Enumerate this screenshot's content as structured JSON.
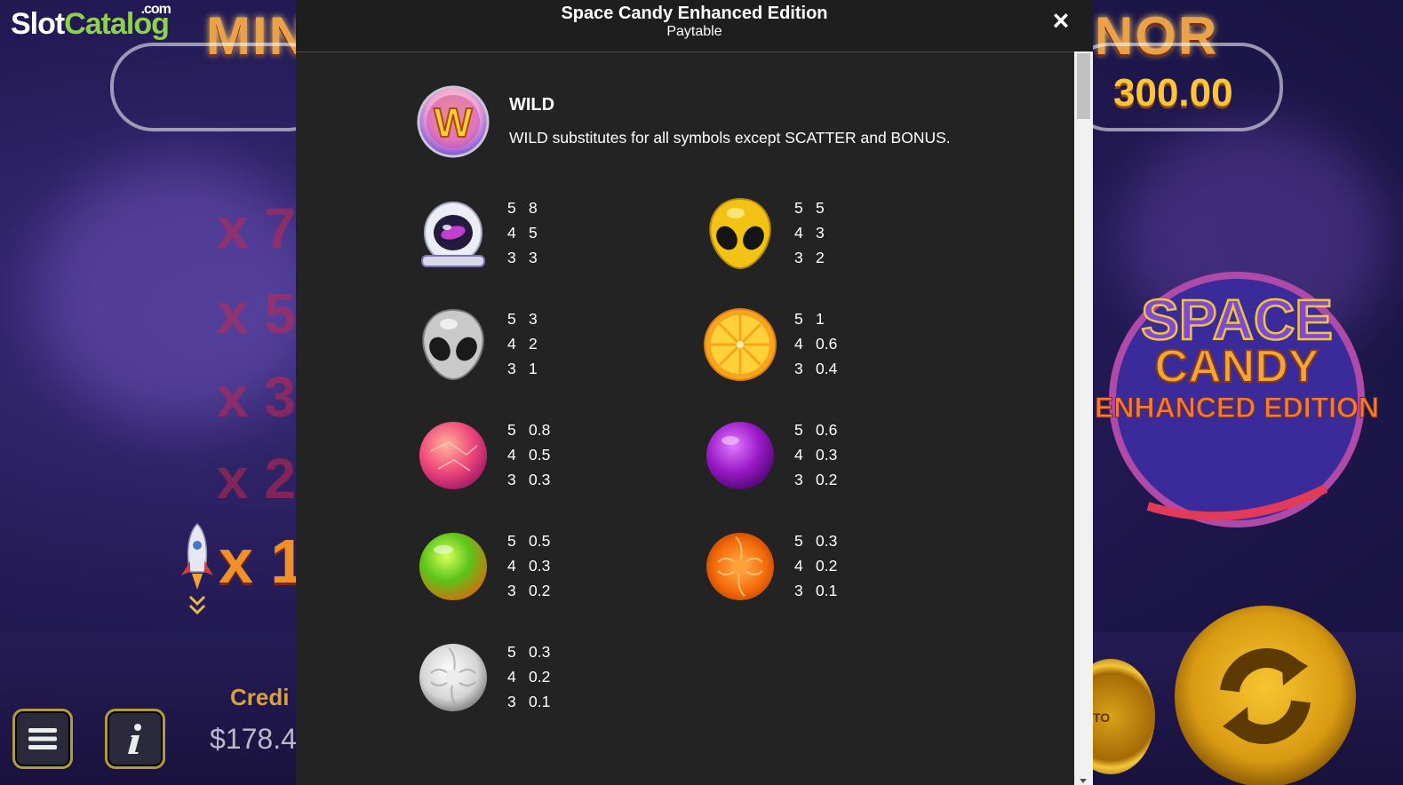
{
  "watermark": {
    "brand_part1": "Slot",
    "brand_part2": "Catalog",
    "brand_suffix": ".com"
  },
  "background": {
    "left_title_partial": "MIN",
    "right_title_partial": "NOR",
    "right_amount": "300.00",
    "multipliers": [
      "x 7",
      "x 5",
      "x 3",
      "x 2"
    ],
    "active_multiplier": "x 1",
    "credit_label": "Credi",
    "credit_value": "$178.4",
    "game_logo": {
      "line1": "SPACE",
      "line2": "CANDY",
      "line3": "ENHANCED EDITION"
    },
    "auto_label": "TO",
    "colors": {
      "accent_gold": "#ffc43a",
      "title_orange": "#e9a24a"
    }
  },
  "paytable": {
    "title": "Space Candy Enhanced Edition",
    "subtitle": "Paytable",
    "close_icon": "×",
    "wild": {
      "name": "WILD",
      "letter": "W",
      "description": "WILD substitutes for all symbols except SCATTER and BONUS."
    },
    "symbols": [
      {
        "icon": "astronaut-helmet-icon",
        "pays": [
          {
            "count": "5",
            "value": "8"
          },
          {
            "count": "4",
            "value": "5"
          },
          {
            "count": "3",
            "value": "3"
          }
        ]
      },
      {
        "icon": "yellow-alien-icon",
        "pays": [
          {
            "count": "5",
            "value": "5"
          },
          {
            "count": "4",
            "value": "3"
          },
          {
            "count": "3",
            "value": "2"
          }
        ]
      },
      {
        "icon": "grey-alien-icon",
        "pays": [
          {
            "count": "5",
            "value": "3"
          },
          {
            "count": "4",
            "value": "2"
          },
          {
            "count": "3",
            "value": "1"
          }
        ]
      },
      {
        "icon": "citrus-candy-icon",
        "pays": [
          {
            "count": "5",
            "value": "1"
          },
          {
            "count": "4",
            "value": "0.6"
          },
          {
            "count": "3",
            "value": "0.4"
          }
        ]
      },
      {
        "icon": "pink-candy-icon",
        "pays": [
          {
            "count": "5",
            "value": "0.8"
          },
          {
            "count": "4",
            "value": "0.5"
          },
          {
            "count": "3",
            "value": "0.3"
          }
        ]
      },
      {
        "icon": "purple-candy-icon",
        "pays": [
          {
            "count": "5",
            "value": "0.6"
          },
          {
            "count": "4",
            "value": "0.3"
          },
          {
            "count": "3",
            "value": "0.2"
          }
        ]
      },
      {
        "icon": "green-candy-icon",
        "pays": [
          {
            "count": "5",
            "value": "0.5"
          },
          {
            "count": "4",
            "value": "0.3"
          },
          {
            "count": "3",
            "value": "0.2"
          }
        ]
      },
      {
        "icon": "orange-swirl-candy-icon",
        "pays": [
          {
            "count": "5",
            "value": "0.3"
          },
          {
            "count": "4",
            "value": "0.2"
          },
          {
            "count": "3",
            "value": "0.1"
          }
        ]
      },
      {
        "icon": "white-swirl-candy-icon",
        "pays": [
          {
            "count": "5",
            "value": "0.3"
          },
          {
            "count": "4",
            "value": "0.2"
          },
          {
            "count": "3",
            "value": "0.1"
          }
        ]
      }
    ]
  }
}
